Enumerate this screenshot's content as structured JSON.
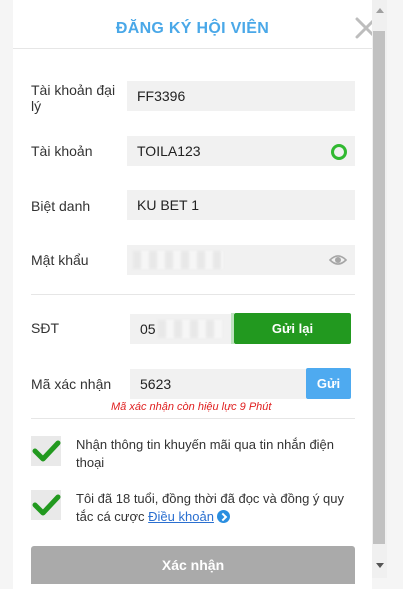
{
  "dialog": {
    "title": "ĐĂNG KÝ HỘI VIÊN",
    "close_icon": "close-icon"
  },
  "form": {
    "agent_account": {
      "label": "Tài khoản đại lý",
      "value": "FF3396"
    },
    "account": {
      "label": "Tài khoản",
      "value": "TOILA123",
      "status_icon": "valid-circle-icon"
    },
    "nickname": {
      "label": "Biệt danh",
      "value": "KU BET 1"
    },
    "password": {
      "label": "Mật khẩu",
      "icon": "eye-icon"
    },
    "phone": {
      "label": "SĐT",
      "value_prefix": "05",
      "resend_label": "Gửi lại"
    },
    "verification_code": {
      "label": "Mã xác nhận",
      "value": "5623",
      "send_label": "Gửi",
      "hint": "Mã xác nhận còn hiệu lực 9 Phút"
    },
    "promo_checkbox": {
      "checked": true,
      "text": "Nhận thông tin khuyến mãi qua tin nhắn điện thoại"
    },
    "terms_checkbox": {
      "checked": true,
      "text": "Tôi đã 18 tuổi, đồng thời đã đọc và đồng ý quy tắc cá cược",
      "link": "Điều khoản"
    },
    "submit_label": "Xác nhận"
  },
  "colors": {
    "title": "#4aa8e8",
    "resend_button": "#22991f",
    "send_button": "#4eaaf0",
    "check": "#22991f",
    "hint": "#e02020",
    "submit_disabled": "#aaaaaa"
  }
}
